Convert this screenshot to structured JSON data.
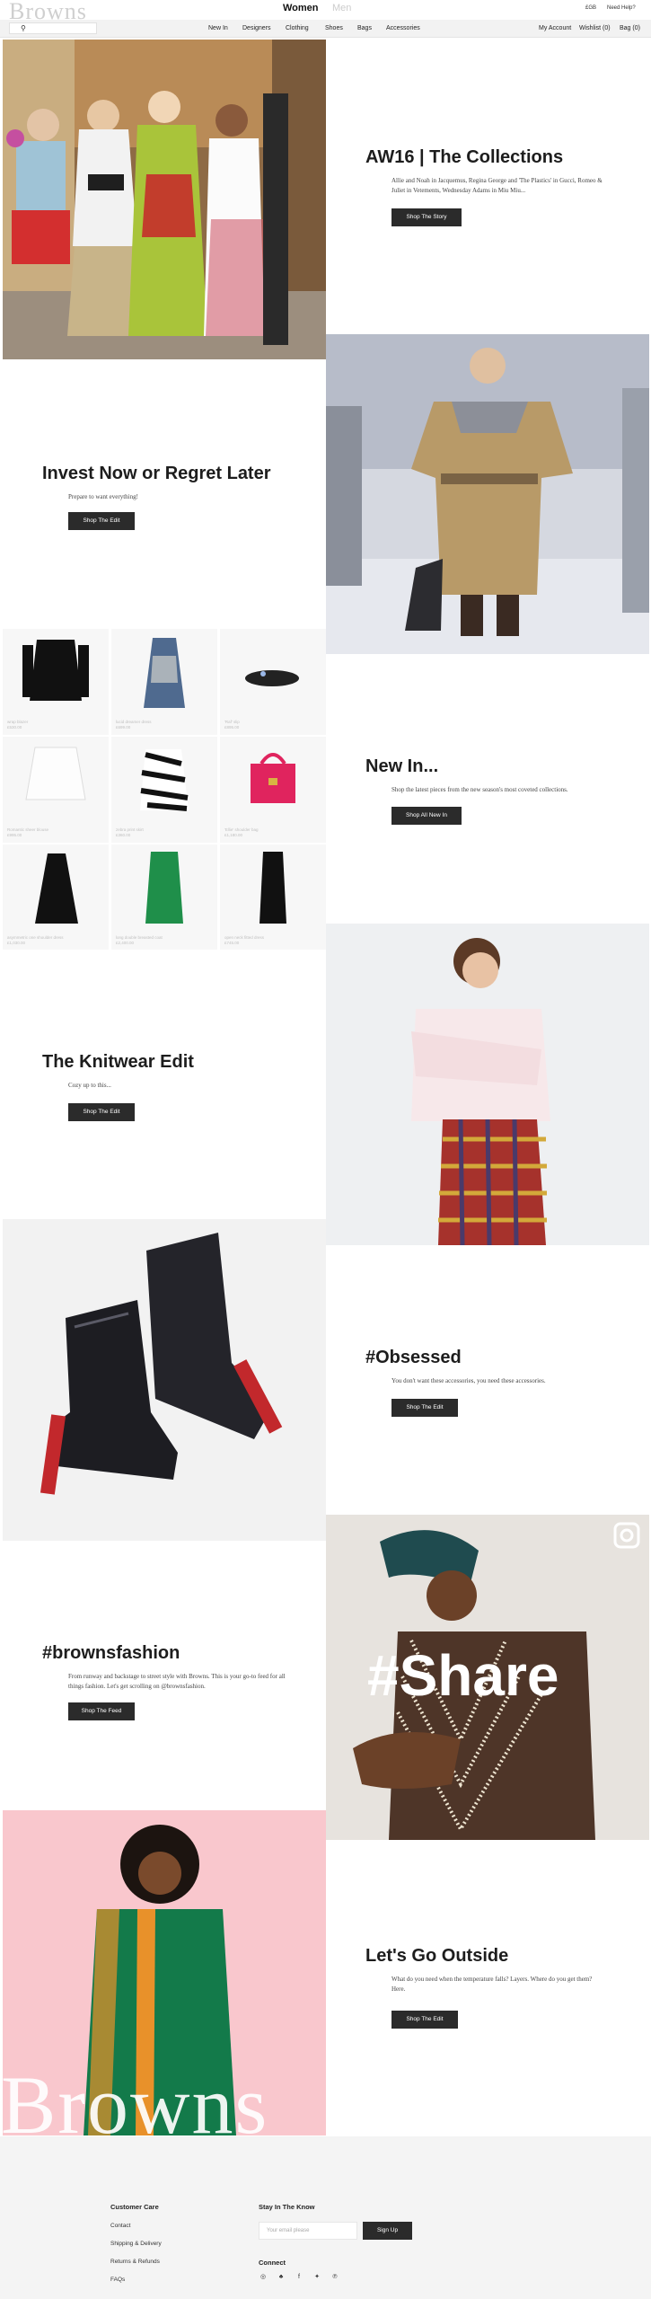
{
  "header": {
    "logo": "Browns",
    "women": "Women",
    "men": "Men",
    "currency": "£GB",
    "help": "Need Help?",
    "account": "My Account",
    "wishlist": "Wishlist (0)",
    "bag": "Bag (0)",
    "nav": [
      "New In",
      "Designers",
      "Clothing",
      "Shoes",
      "Bags",
      "Accessories"
    ]
  },
  "sections": [
    {
      "title": "AW16 | The Collections",
      "text": "Allie and Noah in Jacquemus, Regina George and 'The Plastics' in Gucci, Romeo & Juliet in Vetements, Wednesday Adams in Miu Miu...",
      "button": "Shop The Story"
    },
    {
      "title": "Invest Now or Regret Later",
      "text": "Prepare to want everything!",
      "button": "Shop The Edit"
    },
    {
      "title": "New In...",
      "text": "Shop the latest pieces from the new season's most coveted collections.",
      "button": "Shop All New In"
    },
    {
      "title": "The Knitwear Edit",
      "text": "Cozy up to this...",
      "button": "Shop The Edit"
    },
    {
      "title": "#Obsessed",
      "text": "You don't want these accessories, you need these accessories.",
      "button": "Shop The Edit"
    },
    {
      "title": "#brownsfashion",
      "text": "From runway and backstage to street style with Browns. This is your go-to feed for all things fashion. Let's get scrolling on @brownsfashion.",
      "button": "Shop The Feed"
    },
    {
      "title": "Let's Go Outside",
      "text": "What do you need when the temperature falls? Layers. Where do you get them? Here.",
      "button": "Shop The Edit"
    }
  ],
  "share_text": "#Share",
  "watermark": "Browns",
  "products": [
    {
      "name": "wrap blazer",
      "price": "£530.00"
    },
    {
      "name": "lucid dreamer dress",
      "price": "£699.00"
    },
    {
      "name": "'Raf' slip",
      "price": "£895.00"
    },
    {
      "name": "Romantic sheer blouse",
      "price": "£995.00"
    },
    {
      "name": "zebra print skirt",
      "price": "£360.00"
    },
    {
      "name": "'Ellie' shoulder bag",
      "price": "£1,180.00"
    },
    {
      "name": "asymmetric one shoulder dress",
      "price": "£1,030.00"
    },
    {
      "name": "long double breasted coat",
      "price": "£2,400.00"
    },
    {
      "name": "open neck fitted dress",
      "price": "£745.00"
    }
  ],
  "footer": {
    "customer_care": "Customer Care",
    "links": [
      "Contact",
      "Shipping & Delivery",
      "Returns & Refunds",
      "FAQs"
    ],
    "stay": "Stay In The Know",
    "email_placeholder": "Your email please",
    "signup": "Sign Up",
    "connect": "Connect",
    "social_icons": [
      "instagram-icon",
      "snapchat-icon",
      "facebook-icon",
      "twitter-icon",
      "pinterest-icon"
    ]
  }
}
